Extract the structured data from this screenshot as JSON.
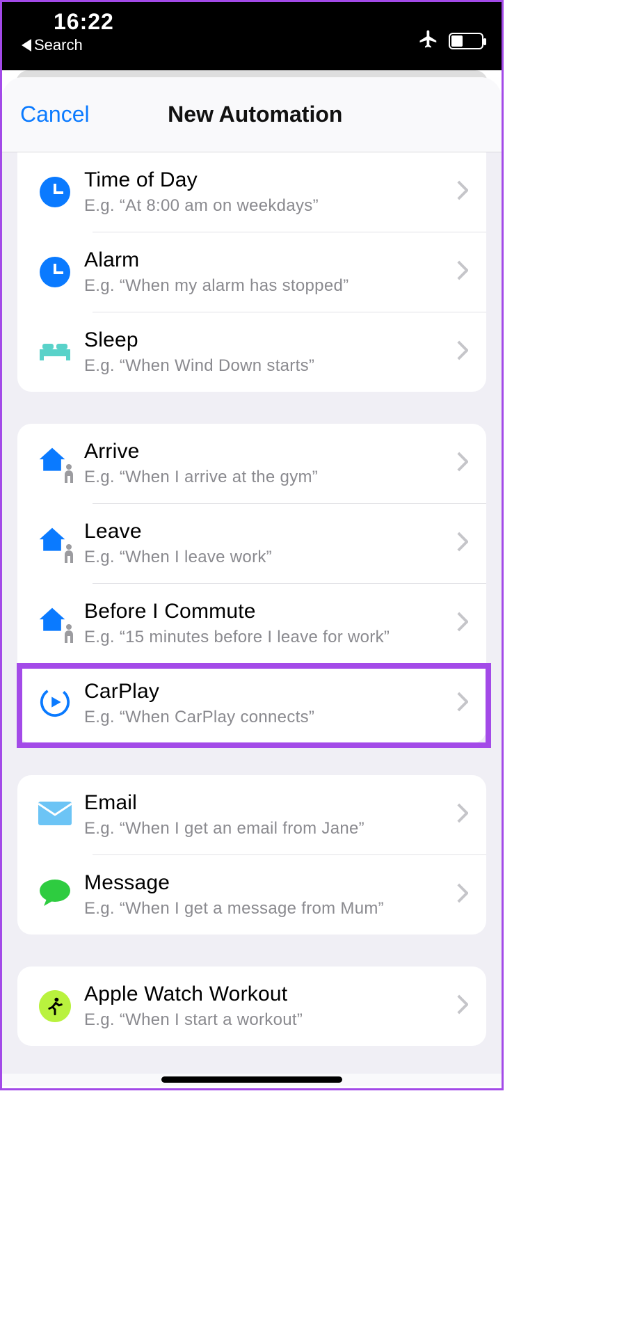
{
  "status": {
    "time": "16:22",
    "back_label": "Search"
  },
  "nav": {
    "cancel": "Cancel",
    "title": "New Automation"
  },
  "groups": [
    {
      "items": [
        {
          "title": "Time of Day",
          "subtitle": "E.g. “At 8:00 am on weekdays”",
          "icon": "clock"
        },
        {
          "title": "Alarm",
          "subtitle": "E.g. “When my alarm has stopped”",
          "icon": "clock"
        },
        {
          "title": "Sleep",
          "subtitle": "E.g. “When Wind Down starts”",
          "icon": "bed"
        }
      ]
    },
    {
      "items": [
        {
          "title": "Arrive",
          "subtitle": "E.g. “When I arrive at the gym”",
          "icon": "home-person"
        },
        {
          "title": "Leave",
          "subtitle": "E.g. “When I leave work”",
          "icon": "home-person"
        },
        {
          "title": "Before I Commute",
          "subtitle": "E.g. “15 minutes before I leave for work”",
          "icon": "home-person"
        },
        {
          "title": "CarPlay",
          "subtitle": "E.g. “When CarPlay connects”",
          "icon": "carplay",
          "highlighted": true
        }
      ]
    },
    {
      "items": [
        {
          "title": "Email",
          "subtitle": "E.g. “When I get an email from Jane”",
          "icon": "mail"
        },
        {
          "title": "Message",
          "subtitle": "E.g. “When I get a message from Mum”",
          "icon": "message"
        }
      ]
    },
    {
      "items": [
        {
          "title": "Apple Watch Workout",
          "subtitle": "E.g. “When I start a workout”",
          "icon": "workout"
        }
      ]
    }
  ]
}
